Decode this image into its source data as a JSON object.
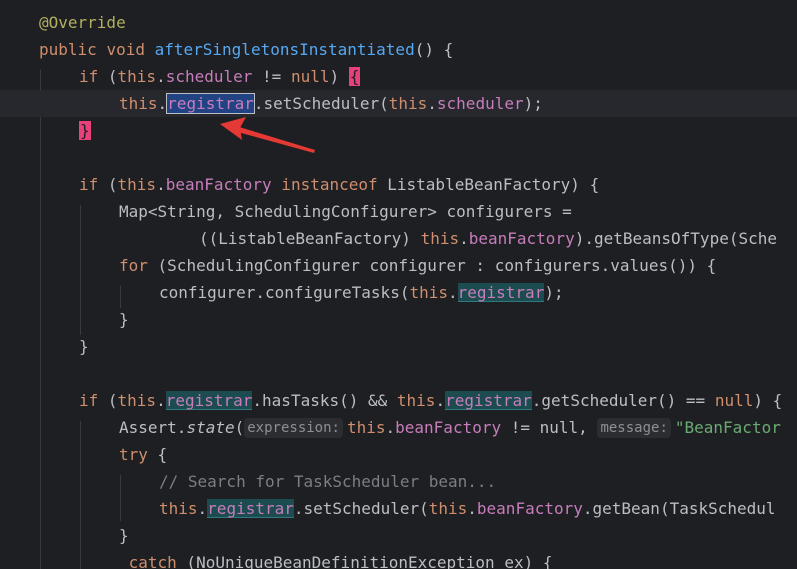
{
  "lines": {
    "annotation": "@Override",
    "method_public": "public",
    "method_void": "void",
    "method_name": "afterSingletonsInstantiated",
    "method_parens": "() {",
    "if1_kw": "if",
    "if1_a": " (",
    "this": "this",
    "dot": ".",
    "scheduler": "scheduler",
    "neq": " != ",
    "null": "null",
    "paren_close": ") ",
    "brace_open": "{",
    "registrar": "registrar",
    "set_scheduler": ".setScheduler(",
    "close_semicolon": ");",
    "brace_close": "}",
    "if2_a": " (",
    "bean_factory": "beanFactory",
    "instanceof": " instanceof ",
    "listable": "ListableBeanFactory",
    "if2_end": ") {",
    "map_decl": "Map<String, SchedulingConfigurer> configurers =",
    "cast_open": "((ListableBeanFactory) ",
    "get_beans": ").getBeansOfType(Sche",
    "for_kw": "for",
    "for_body": " (SchedulingConfigurer configurer : configurers.values()) {",
    "configure_call": "configurer.configureTasks(",
    "if3_has_tasks": ".hasTasks() && ",
    "get_scheduler": ".getScheduler() == ",
    "if3_end": ") {",
    "assert_prefix": "Assert.",
    "state": "state",
    "paren_open": "(",
    "hint_expression": "expression:",
    "neq_null_comma": " != null, ",
    "hint_message": "message:",
    "bean_factor_str": "\"BeanFactor",
    "try_kw": "try",
    "try_brace": " {",
    "comment": "// Search for TaskScheduler bean...",
    "get_bean": ".getBean(TaskSchedul",
    "catch_kw": " catch",
    "catch_body": " (NoUniqueBeanDefinitionException ex) {"
  },
  "colors": {
    "background": "#1e1f22",
    "keyword": "#cf8e6d",
    "field": "#c77dbb",
    "method": "#56a8f5",
    "annotation": "#b3ae60",
    "string": "#6aab73",
    "highlight": "#1c4c50",
    "arrow": "#e53935"
  }
}
